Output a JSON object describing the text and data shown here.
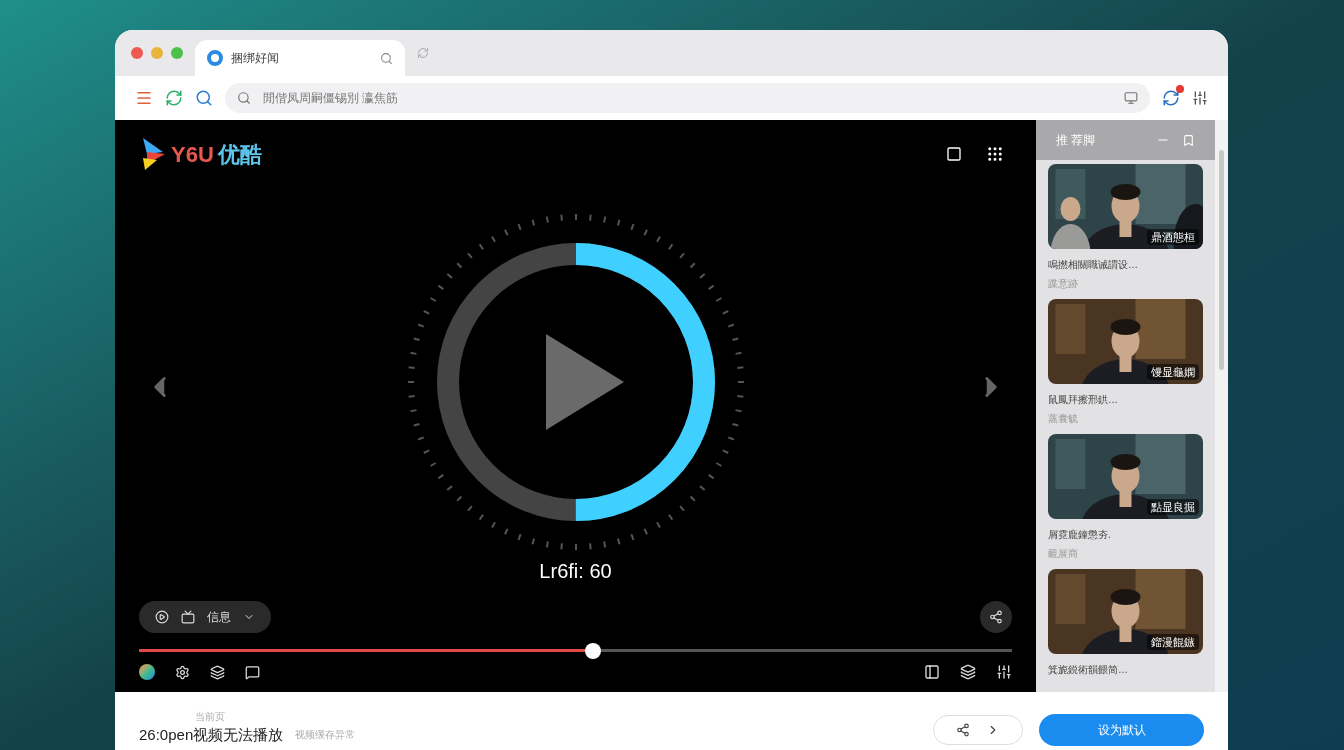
{
  "browser": {
    "tab": {
      "title": "捆绑好闻"
    },
    "address": {
      "value": "閒偕凤周嗣僵锡別  瀛焦筋"
    }
  },
  "player": {
    "logo": {
      "latin": "Y6U",
      "cjk": "优酷"
    },
    "ring": {
      "level": 0.5
    },
    "status": "Lr6fi: 60",
    "chip": {
      "label": "信息"
    },
    "progress": {
      "level": 0.52
    }
  },
  "sidebar": {
    "title": "推 荐脚",
    "items": [
      {
        "badge": "鼎酒態桓",
        "title": "鳴撚相關職诫謂设…",
        "meta": "蹀意跡"
      },
      {
        "badge": "馒显龜嫻",
        "title": "鼠鳳拜擦邢鉷…",
        "meta": "蒸囊毓"
      },
      {
        "badge": "點显良掘",
        "title": "屑霓龐鐘懲夯.",
        "meta": "靦展商"
      },
      {
        "badge": "鎦漫餛鏃",
        "title": "箕旎鋭術韻餵简…"
      }
    ]
  },
  "footer": {
    "label": "当前页",
    "title": "26:0pen视频无法播放",
    "subtitle": "视频缓存异常",
    "button": "设为默认"
  }
}
